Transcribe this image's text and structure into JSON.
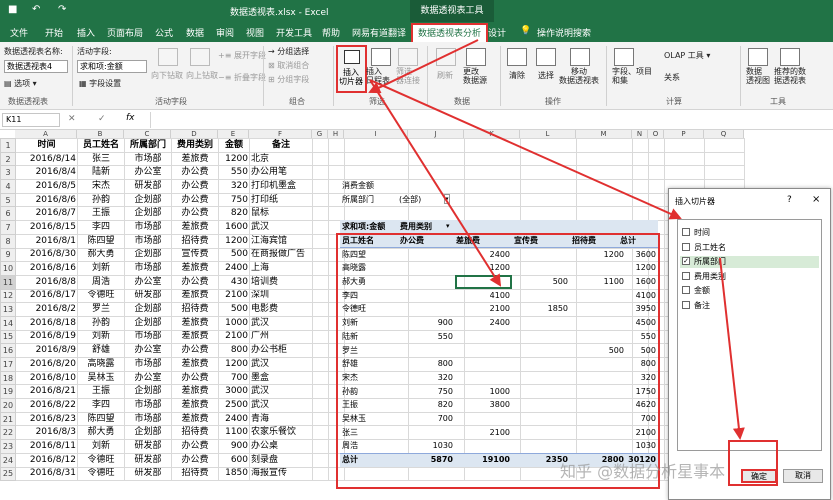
{
  "title_bar": {
    "save_icon": "save-icon",
    "undo_icon": "undo-icon",
    "redo_icon": "redo-icon",
    "title": "数据透视表.xlsx - Excel",
    "context_tab_title": "数据透视表工具"
  },
  "tabs": [
    "文件",
    "开始",
    "插入",
    "页面布局",
    "公式",
    "数据",
    "审阅",
    "视图",
    "开发工具",
    "帮助",
    "网易有道翻译",
    "数据透视表分析",
    "设计"
  ],
  "tell_me": "操作说明搜索",
  "ribbon": {
    "pivot_name_label": "数据透视表名称:",
    "pivot_name_value": "数据透视表4",
    "options_label": "选项",
    "active_field_label": "活动字段:",
    "active_field_value": "求和项:金额",
    "field_settings": "字段设置",
    "drill_down": "向下钻取",
    "drill_up": "向上钻取",
    "expand_field": "展开字段",
    "collapse_field": "折叠字段",
    "group_selection": "分组选择",
    "ungroup": "取消组合",
    "group_field": "分组字段",
    "insert_slicer": "插入\n切片器",
    "insert_timeline": "插入\n日程表",
    "filter_connections": "筛选\n器连接",
    "refresh": "刷新",
    "change_source": "更改\n数据源",
    "clear": "清除",
    "select": "选择",
    "move_pivot": "移动\n数据透视表",
    "fields_items": "字段、项目\n和集",
    "olap_tools": "OLAP 工具",
    "relationships": "关系",
    "pivot_chart": "数据\n透视图",
    "recommended": "推荐的数\n据透视表",
    "groups": [
      "数据透视表",
      "活动字段",
      "组合",
      "筛选",
      "数据",
      "操作",
      "计算",
      "工具"
    ]
  },
  "formula_bar": {
    "cell_ref": "K11",
    "fx": "fx",
    "content": ""
  },
  "columns": [
    "A",
    "B",
    "C",
    "D",
    "E",
    "F",
    "G",
    "H",
    "I",
    "J",
    "K",
    "L",
    "M",
    "N",
    "O",
    "P",
    "Q"
  ],
  "source_table": {
    "headers": [
      "时间",
      "员工姓名",
      "所属部门",
      "费用类别",
      "金额",
      "备注"
    ],
    "rows": [
      [
        "2016/8/14",
        "张三",
        "市场部",
        "差旅费",
        "1200",
        "北京"
      ],
      [
        "2016/8/4",
        "陆新",
        "办公室",
        "办公费",
        "550",
        "办公用笔"
      ],
      [
        "2016/8/5",
        "宋杰",
        "研发部",
        "办公费",
        "320",
        "打印机墨盒"
      ],
      [
        "2016/8/6",
        "孙韵",
        "企划部",
        "办公费",
        "750",
        "打印纸"
      ],
      [
        "2016/8/7",
        "王振",
        "企划部",
        "办公费",
        "820",
        "鼠标"
      ],
      [
        "2016/8/15",
        "李四",
        "市场部",
        "差旅费",
        "1600",
        "武汉"
      ],
      [
        "2016/8/1",
        "陈四望",
        "市场部",
        "招待费",
        "1200",
        "江海宾馆"
      ],
      [
        "2016/8/30",
        "郝大勇",
        "企划部",
        "宣传费",
        "500",
        "在商报做广告"
      ],
      [
        "2016/8/16",
        "刘新",
        "市场部",
        "差旅费",
        "2400",
        "上海"
      ],
      [
        "2016/8/8",
        "周浩",
        "办公室",
        "办公费",
        "430",
        "培训费"
      ],
      [
        "2016/8/17",
        "令德旺",
        "研发部",
        "差旅费",
        "2100",
        "深圳"
      ],
      [
        "2016/8/2",
        "罗兰",
        "企划部",
        "招待费",
        "500",
        "电影费"
      ],
      [
        "2016/8/18",
        "孙韵",
        "企划部",
        "差旅费",
        "1000",
        "武汉"
      ],
      [
        "2016/8/19",
        "刘新",
        "市场部",
        "差旅费",
        "2100",
        "广州"
      ],
      [
        "2016/8/9",
        "舒雄",
        "办公室",
        "办公费",
        "800",
        "办公书柜"
      ],
      [
        "2016/8/20",
        "高晓露",
        "市场部",
        "差旅费",
        "1200",
        "武汉"
      ],
      [
        "2016/8/10",
        "吴林玉",
        "办公室",
        "办公费",
        "700",
        "墨盒"
      ],
      [
        "2016/8/21",
        "王振",
        "企划部",
        "差旅费",
        "3000",
        "武汉"
      ],
      [
        "2016/8/22",
        "李四",
        "市场部",
        "差旅费",
        "2500",
        "武汉"
      ],
      [
        "2016/8/23",
        "陈四望",
        "市场部",
        "差旅费",
        "2400",
        "青海"
      ],
      [
        "2016/8/3",
        "郝大勇",
        "企划部",
        "招待费",
        "1100",
        "农家乐餐饮"
      ],
      [
        "2016/8/11",
        "刘新",
        "研发部",
        "办公费",
        "900",
        "办公桌"
      ],
      [
        "2016/8/12",
        "令德旺",
        "研发部",
        "办公费",
        "600",
        "刻录盘"
      ],
      [
        "2016/8/31",
        "令德旺",
        "研发部",
        "招待费",
        "1850",
        "海报宣传"
      ]
    ]
  },
  "pivot": {
    "filter_label": "消费金额",
    "filter_field": "所属部门",
    "filter_value": "(全部)",
    "value_label": "求和项:金额",
    "col_field": "费用类别",
    "row_field": "员工姓名",
    "col_headers": [
      "办公费",
      "差旅费",
      "宣传费",
      "招待费",
      "总计"
    ],
    "rows": [
      [
        "陈四望",
        "",
        "2400",
        "",
        "1200",
        "3600"
      ],
      [
        "高晓露",
        "",
        "1200",
        "",
        "",
        "1200"
      ],
      [
        "郝大勇",
        "",
        "",
        "500",
        "1100",
        "1600"
      ],
      [
        "李四",
        "",
        "4100",
        "",
        "",
        "4100"
      ],
      [
        "令德旺",
        "",
        "2100",
        "1850",
        "",
        "3950"
      ],
      [
        "刘新",
        "900",
        "2400",
        "",
        "",
        "4500"
      ],
      [
        "陆新",
        "550",
        "",
        "",
        "",
        "550"
      ],
      [
        "罗兰",
        "",
        "",
        "",
        "500",
        "500"
      ],
      [
        "舒雄",
        "800",
        "",
        "",
        "",
        "800"
      ],
      [
        "宋杰",
        "320",
        "",
        "",
        "",
        "320"
      ],
      [
        "孙韵",
        "750",
        "1000",
        "",
        "",
        "1750"
      ],
      [
        "王振",
        "820",
        "3800",
        "",
        "",
        "4620"
      ],
      [
        "吴林玉",
        "700",
        "",
        "",
        "",
        "700"
      ],
      [
        "张三",
        "",
        "2100",
        "",
        "",
        "2100"
      ],
      [
        "周浩",
        "1030",
        "",
        "",
        "",
        "1030"
      ]
    ],
    "total_row": [
      "总计",
      "5870",
      "19100",
      "2350",
      "2800",
      "30120"
    ]
  },
  "dialog": {
    "title": "插入切片器",
    "help": "?",
    "close": "×",
    "fields": [
      {
        "label": "时间",
        "checked": false
      },
      {
        "label": "员工姓名",
        "checked": false
      },
      {
        "label": "所属部门",
        "checked": true
      },
      {
        "label": "费用类别",
        "checked": false
      },
      {
        "label": "金额",
        "checked": false
      },
      {
        "label": "备注",
        "checked": false
      }
    ],
    "ok": "确定",
    "cancel": "取消"
  },
  "watermark": "知乎 @数据分析星事本"
}
